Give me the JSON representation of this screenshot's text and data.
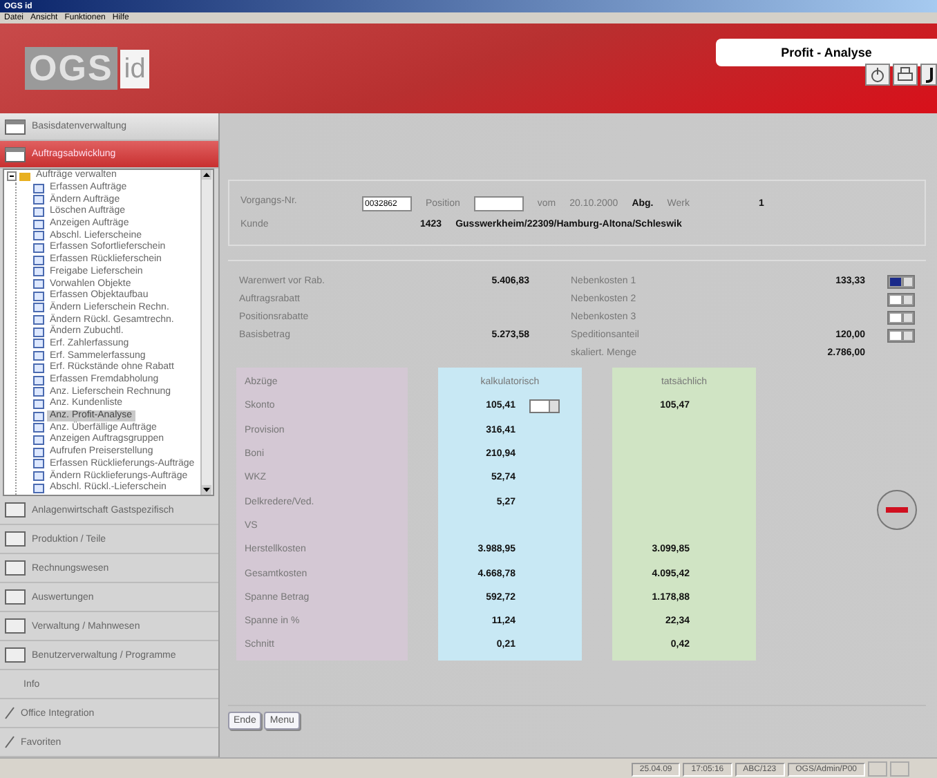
{
  "window": {
    "title": "OGS id"
  },
  "menu": [
    "Datei",
    "Ansicht",
    "Funktionen",
    "Hilfe"
  ],
  "header": {
    "logo": "OGS",
    "logo_suffix": "id",
    "tab": "Profit - Analyse"
  },
  "sidebar": {
    "top": [
      {
        "label": "Basisdatenverwaltung",
        "selected": false
      },
      {
        "label": "Auftragsabwicklung",
        "selected": true
      }
    ],
    "tree": {
      "label": "Aufträge verwalten",
      "expanded": true,
      "children": [
        {
          "label": "Erfassen Aufträge",
          "selected": false
        },
        {
          "label": "Ändern Aufträge",
          "selected": false
        },
        {
          "label": "Löschen Aufträge",
          "selected": false
        },
        {
          "label": "Anzeigen Aufträge",
          "selected": false
        },
        {
          "label": "Abschl. Lieferscheine",
          "selected": false
        },
        {
          "label": "Erfassen Sofortlieferschein",
          "selected": false
        },
        {
          "label": "Erfassen Rücklieferschein",
          "selected": false
        },
        {
          "label": "Freigabe Lieferschein",
          "selected": false
        },
        {
          "label": "Vorwahlen Objekte",
          "selected": false
        },
        {
          "label": "Erfassen Objektaufbau",
          "selected": false
        },
        {
          "label": "Ändern Lieferschein Rechn.",
          "selected": false
        },
        {
          "label": "Ändern Rückl. Gesamtrechn.",
          "selected": false
        },
        {
          "label": "Ändern Zubuchtl.",
          "selected": false
        },
        {
          "label": "Erf. Zahlerfassung",
          "selected": false
        },
        {
          "label": "Erf. Sammelerfassung",
          "selected": false
        },
        {
          "label": "Erf. Rückstände ohne Rabatt",
          "selected": false
        },
        {
          "label": "Erfassen Fremdabholung",
          "selected": false
        },
        {
          "label": "Anz. Lieferschein Rechnung",
          "selected": false
        },
        {
          "label": "Anz. Kundenliste",
          "selected": false
        },
        {
          "label": "Anz. Profit-Analyse",
          "selected": true
        },
        {
          "label": "Anz. Überfällige Aufträge",
          "selected": false
        },
        {
          "label": "Anzeigen Auftragsgruppen",
          "selected": false
        },
        {
          "label": "Aufrufen Preiserstellung",
          "selected": false
        },
        {
          "label": "Erfassen Rücklieferungs-Aufträge",
          "selected": false
        },
        {
          "label": "Ändern Rücklieferungs-Aufträge",
          "selected": false
        },
        {
          "label": "Abschl. Rückl.-Lieferschein",
          "selected": false
        }
      ]
    },
    "bottom": [
      {
        "label": "Anlagenwirtschaft Gastspezifisch",
        "kind": "boxed"
      },
      {
        "label": "Produktion / Teile",
        "kind": "boxed"
      },
      {
        "label": "Rechnungswesen",
        "kind": "boxed"
      },
      {
        "label": "Auswertungen",
        "kind": "boxed"
      },
      {
        "label": "Verwaltung / Mahnwesen",
        "kind": "boxed"
      },
      {
        "label": "Benutzerverwaltung / Programme",
        "kind": "boxed"
      },
      {
        "label": "Info",
        "kind": "plain"
      },
      {
        "label": "Office Integration",
        "kind": "small"
      },
      {
        "label": "Favoriten",
        "kind": "small"
      }
    ]
  },
  "order": {
    "number_label": "Vorgangs-Nr.",
    "number": "0032862",
    "position_label": "Position",
    "from_label": "vom",
    "date": "20.10.2000",
    "abg": "Abg.",
    "werk_label": "Werk",
    "werk": "1",
    "customer_label": "Kunde",
    "customer_no": "1423",
    "customer": "Gusswerkheim/22309/Hamburg-Altona/Schleswik"
  },
  "costs": {
    "left": [
      {
        "label": "Warenwert vor Rab.",
        "value": "5.406,83"
      },
      {
        "label": "Auftragsrabatt"
      },
      {
        "label": "Positionsrabatte"
      },
      {
        "label": "Basisbetrag",
        "value": "5.273,58"
      }
    ],
    "right": [
      {
        "label": "Nebenkosten 1",
        "value": "133,33",
        "kind": "dropdown",
        "color": "#1a2a8a"
      },
      {
        "label": "Nebenkosten 2",
        "kind": "dropdown",
        "color": "#ffffff"
      },
      {
        "label": "Nebenkosten 3",
        "kind": "dropdown",
        "color": "#ffffff"
      },
      {
        "label": "Speditionsanteil",
        "value": "120,00",
        "kind": "dropdown",
        "color": "#ffffff"
      },
      {
        "label": "skaliert. Menge",
        "value": "2.786,00",
        "kind": "plain"
      }
    ]
  },
  "calc": {
    "columns": [
      "Abzüge",
      "kalkulatorisch",
      "tatsächlich"
    ],
    "rows": [
      {
        "label": "Skonto",
        "calc": "105,41",
        "actual": "105,47",
        "kind": "dropdown"
      },
      {
        "label": "Provision",
        "calc": "316,41",
        "kind": "plain"
      },
      {
        "label": "Boni",
        "calc": "210,94",
        "kind": "plain"
      },
      {
        "label": "WKZ",
        "calc": "52,74",
        "kind": "plain"
      },
      {
        "label": "Delkredere/Ved.",
        "calc": "5,27",
        "kind": "plain"
      },
      {
        "label": "VS",
        "kind": "plain"
      },
      {
        "label": "Herstellkosten",
        "calc": "3.988,95",
        "actual": "3.099,85",
        "kind": "plain"
      },
      {
        "label": "Gesamtkosten",
        "calc": "4.668,78",
        "actual": "4.095,42",
        "kind": "plain"
      },
      {
        "label": "Spanne Betrag",
        "calc": "592,72",
        "actual": "1.178,88",
        "kind": "plain"
      },
      {
        "label": "Spanne in %",
        "calc": "11,24",
        "actual": "22,34",
        "kind": "plain"
      },
      {
        "label": "Schnitt",
        "calc": "0,21",
        "actual": "0,42",
        "kind": "plain"
      }
    ]
  },
  "buttons": [
    "Ende",
    "Menu"
  ],
  "status_bar": [
    "25.04.09",
    "17:05:16",
    "ABC/123",
    "OGS/Admin/P00"
  ]
}
